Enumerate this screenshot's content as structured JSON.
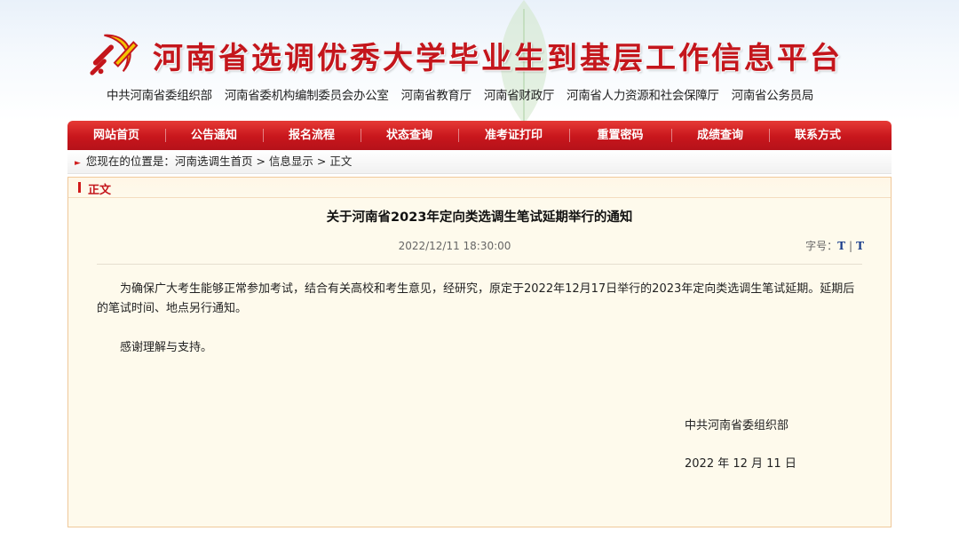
{
  "header": {
    "site_title": "河南省选调优秀大学毕业生到基层工作信息平台",
    "sponsors": [
      "中共河南省委组织部",
      "河南省委机构编制委员会办公室",
      "河南省教育厅",
      "河南省财政厅",
      "河南省人力资源和社会保障厅",
      "河南省公务员局"
    ]
  },
  "nav": {
    "items": [
      "网站首页",
      "公告通知",
      "报名流程",
      "状态查询",
      "准考证打印",
      "重置密码",
      "成绩查询",
      "联系方式"
    ]
  },
  "breadcrumb": {
    "prefix": "您现在的位置是：",
    "home": "河南选调生首页",
    "sep": ">",
    "info": "信息显示",
    "current": "正文"
  },
  "panel": {
    "title": "正文"
  },
  "article": {
    "title": "关于河南省2023年定向类选调生笔试延期举行的通知",
    "datetime": "2022/12/11 18:30:00",
    "fontsize_label": "字号：",
    "fontsize_large": "T",
    "fontsize_sep": "|",
    "fontsize_small": "T",
    "paragraphs": [
      "为确保广大考生能够正常参加考试，结合有关高校和考生意见，经研究，原定于2022年12月17日举行的2023年定向类选调生笔试延期。延期后的笔试时间、地点另行通知。",
      "感谢理解与支持。"
    ],
    "signature": "中共河南省委组织部",
    "sign_date": "2022 年 12 月 11 日"
  },
  "colors": {
    "brand_red": "#c4161c",
    "panel_bg": "#fefaec",
    "panel_border": "#f0c89a",
    "link_blue": "#1a3d8c"
  },
  "icons": [
    "party-emblem-icon",
    "breadcrumb-arrow-icon"
  ]
}
